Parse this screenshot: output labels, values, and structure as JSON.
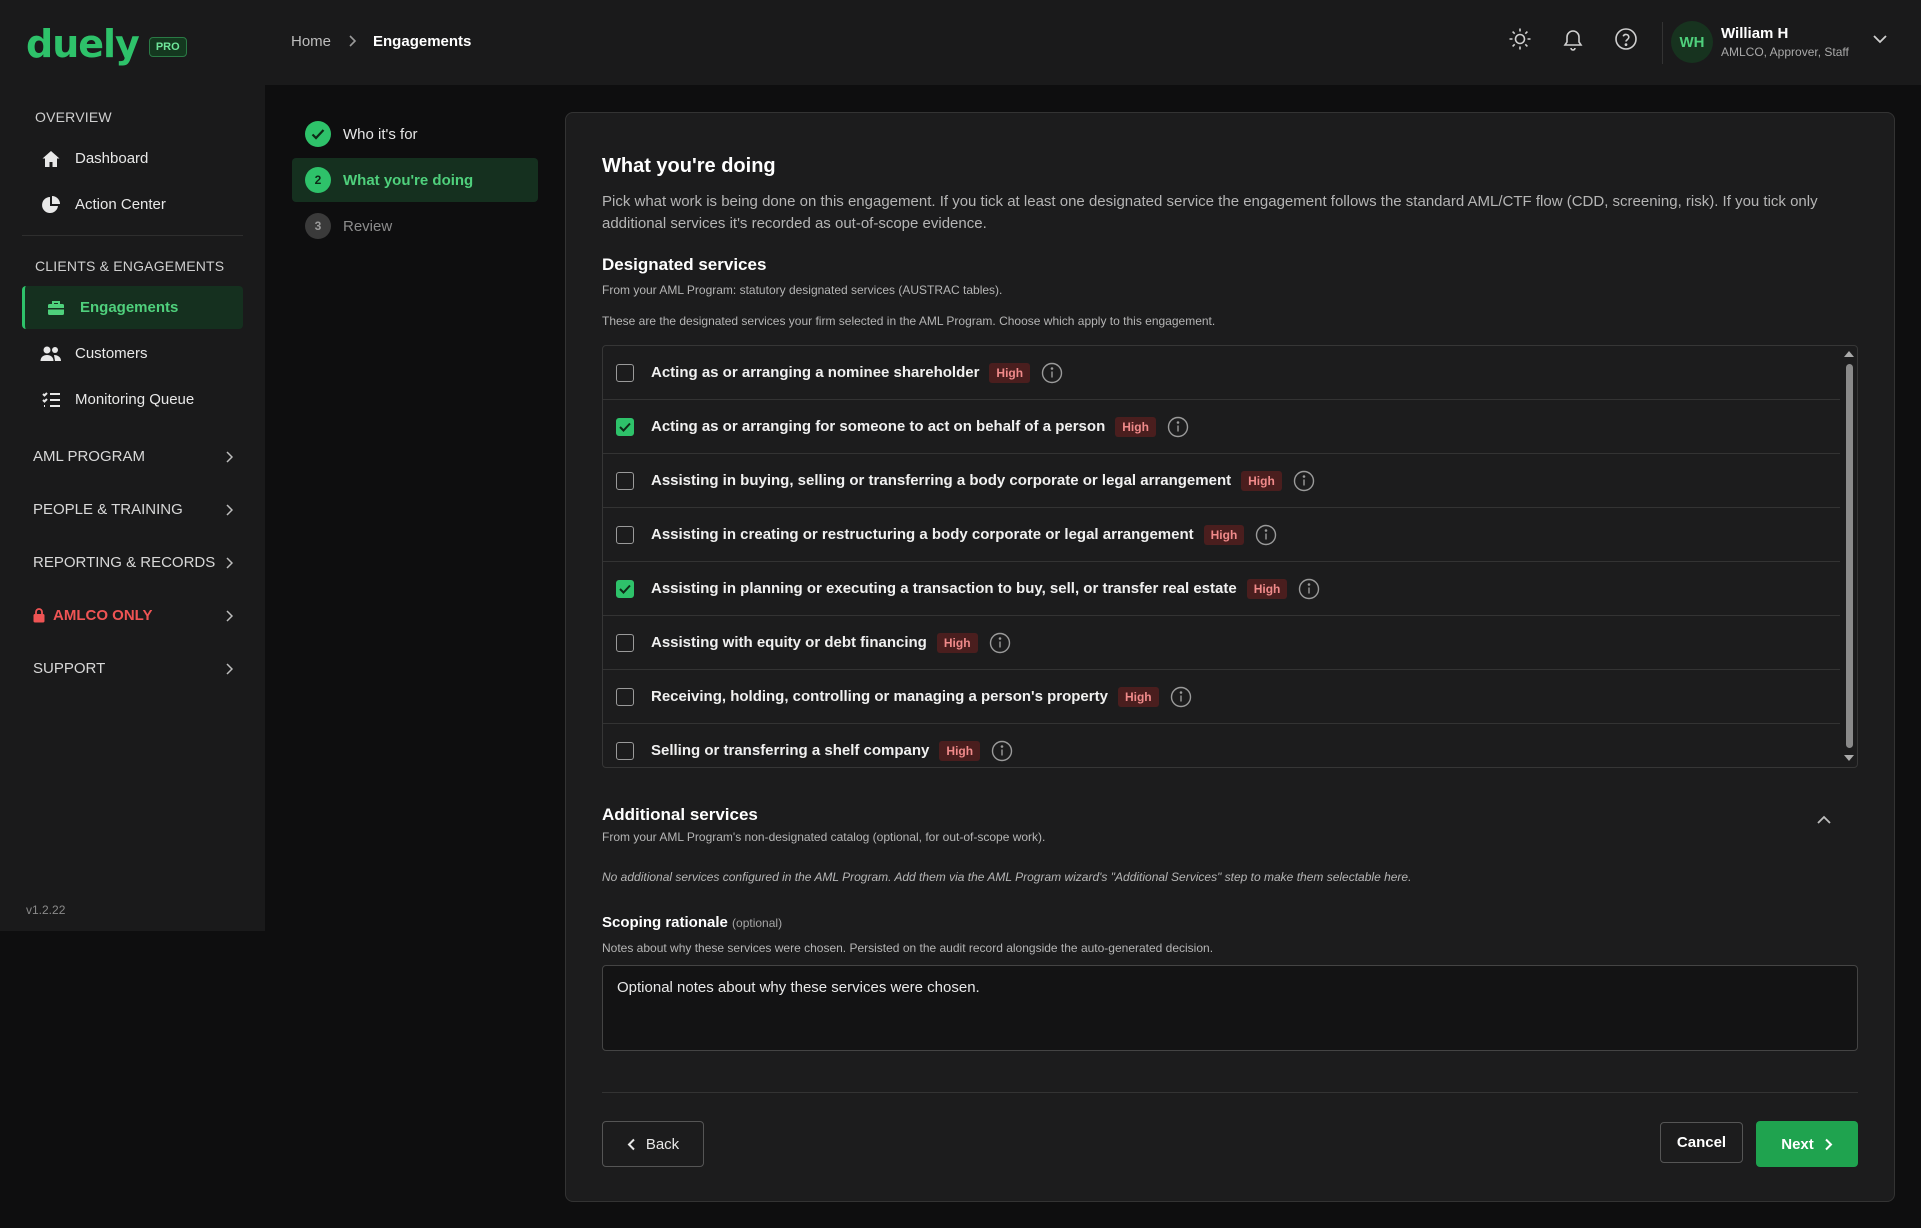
{
  "app": {
    "logo": "duely",
    "plan_badge": "PRO",
    "version": "v1.2.22"
  },
  "breadcrumb": {
    "home": "Home",
    "current": "Engagements"
  },
  "user": {
    "initials": "WH",
    "name": "William H",
    "roles": "AMLCO, Approver, Staff"
  },
  "sidebar": {
    "overview_label": "OVERVIEW",
    "dashboard": "Dashboard",
    "action_center": "Action Center",
    "clients_label": "CLIENTS & ENGAGEMENTS",
    "engagements": "Engagements",
    "customers": "Customers",
    "monitoring_queue": "Monitoring Queue",
    "groups": {
      "aml_program": "AML PROGRAM",
      "people_training": "PEOPLE & TRAINING",
      "reporting_records": "REPORTING & RECORDS",
      "amlco_only": "AMLCO ONLY",
      "support": "SUPPORT"
    }
  },
  "stepper": {
    "step1": "Who it's for",
    "step2_num": "2",
    "step2": "What you're doing",
    "step3_num": "3",
    "step3": "Review"
  },
  "main": {
    "title": "What you're doing",
    "description": "Pick what work is being done on this engagement. If you tick at least one designated service the engagement follows the standard AML/CTF flow (CDD, screening, risk). If you tick only additional services it's recorded as out-of-scope evidence.",
    "designated": {
      "title": "Designated services",
      "source_note": "From your AML Program: statutory designated services (AUSTRAC tables).",
      "instruction": "These are the designated services your firm selected in the AML Program. Choose which apply to this engagement.",
      "risk_label": "High",
      "items": [
        {
          "label": "Acting as or arranging a nominee shareholder",
          "checked": false
        },
        {
          "label": "Acting as or arranging for someone to act on behalf of a person",
          "checked": true
        },
        {
          "label": "Assisting in buying, selling or transferring a body corporate or legal arrangement",
          "checked": false
        },
        {
          "label": "Assisting in creating or restructuring a body corporate or legal arrangement",
          "checked": false
        },
        {
          "label": "Assisting in planning or executing a transaction to buy, sell, or transfer real estate",
          "checked": true
        },
        {
          "label": "Assisting with equity or debt financing",
          "checked": false
        },
        {
          "label": "Receiving, holding, controlling or managing a person's property",
          "checked": false
        },
        {
          "label": "Selling or transferring a shelf company",
          "checked": false
        }
      ]
    },
    "additional": {
      "title": "Additional services",
      "source_note": "From your AML Program's non-designated catalog (optional, for out-of-scope work).",
      "empty_note": "No additional services configured in the AML Program. Add them via the AML Program wizard's \"Additional Services\" step to make them selectable here."
    },
    "rationale": {
      "label": "Scoping rationale",
      "optional": "(optional)",
      "note": "Notes about why these services were chosen. Persisted on the audit record alongside the auto-generated decision.",
      "placeholder": "Optional notes about why these services were chosen."
    },
    "buttons": {
      "back": "Back",
      "cancel": "Cancel",
      "next": "Next"
    }
  },
  "colors": {
    "accent": "#2ec26a",
    "danger": "#ef5454",
    "risk_badge_bg": "#4a1e1e"
  }
}
